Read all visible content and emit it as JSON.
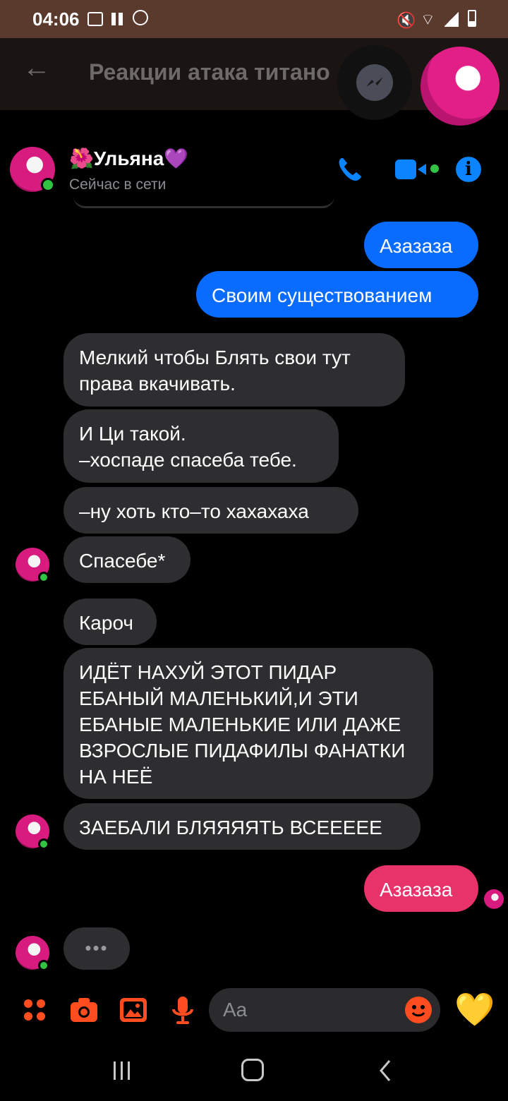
{
  "status_bar": {
    "time": "04:06"
  },
  "background_app": {
    "title": "Реакции атака титано"
  },
  "chat": {
    "contact_name": "Ульяна",
    "contact_prefix_emoji": "🌺",
    "contact_suffix_emoji": "💜",
    "presence": "Сейчас в сети"
  },
  "messages": [
    {
      "dir": "out",
      "text": "Азазаза"
    },
    {
      "dir": "out",
      "text": "Своим существованием"
    },
    {
      "dir": "in",
      "text": "Мелкий чтобы Блять свои тут права вкачивать."
    },
    {
      "dir": "in",
      "text": "И Ци такой.\n–хоспаде спасеба тебе."
    },
    {
      "dir": "in",
      "text": "–ну хоть кто–то хахахаха"
    },
    {
      "dir": "in",
      "text": "Спасебе*"
    },
    {
      "dir": "in",
      "text": "Кароч"
    },
    {
      "dir": "in",
      "text": "ИДЁТ НАХУЙ ЭТОТ ПИДАР ЕБАНЫЙ МАЛЕНЬКИЙ,И ЭТИ ЕБАНЫЕ МАЛЕНЬКИЕ ИЛИ ДАЖЕ ВЗРОСЛЫЕ ПИДАФИЛЫ ФАНАТКИ НА НЕЁ"
    },
    {
      "dir": "in",
      "text": "ЗАЕБАЛИ БЛЯЯЯЯТЬ ВСЕЕЕЕЕ"
    },
    {
      "dir": "out",
      "text": "Азазаза"
    }
  ],
  "typing_indicator": "•••",
  "composer": {
    "placeholder": "Aa",
    "like_emoji": "💛"
  },
  "icons": {
    "call": "phone-icon",
    "video": "video-camera-icon",
    "info": "info-icon",
    "menu": "four-dots-icon",
    "camera": "camera-icon",
    "gallery": "image-icon",
    "mic": "microphone-icon",
    "emoji": "smiley-icon"
  },
  "colors": {
    "accent": "#0a6cff",
    "outgoing_pink": "#e8326a",
    "incoming": "#2e2e30",
    "composer_icons": "#ff4d1f"
  }
}
